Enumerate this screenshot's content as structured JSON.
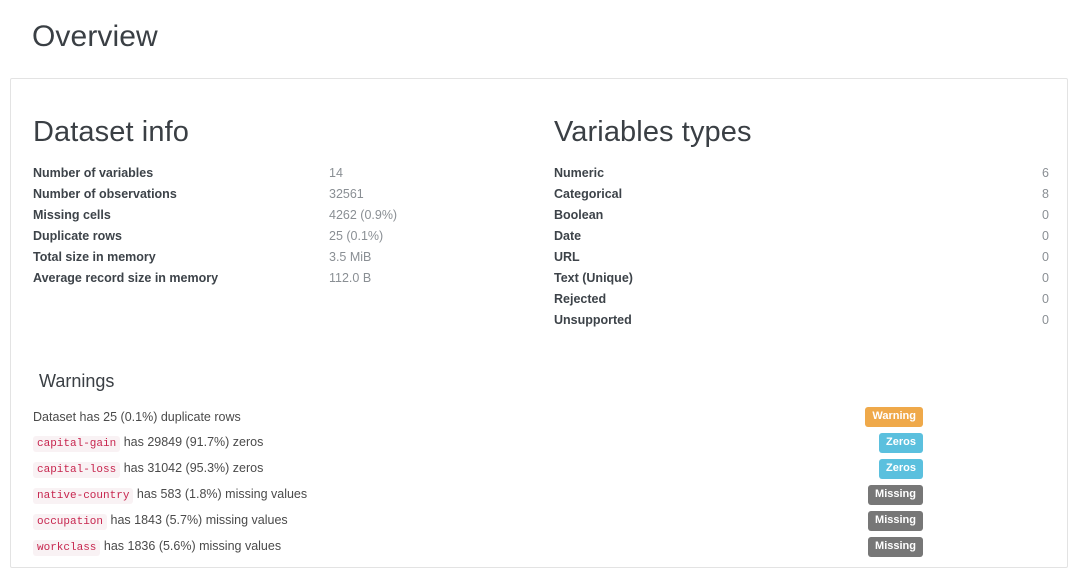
{
  "page": {
    "title": "Overview"
  },
  "dataset_info": {
    "heading": "Dataset info",
    "rows": [
      {
        "label": "Number of variables",
        "value": "14"
      },
      {
        "label": "Number of observations",
        "value": "32561"
      },
      {
        "label": "Missing cells",
        "value": "4262 (0.9%)"
      },
      {
        "label": "Duplicate rows",
        "value": "25 (0.1%)"
      },
      {
        "label": "Total size in memory",
        "value": "3.5 MiB"
      },
      {
        "label": "Average record size in memory",
        "value": "112.0 B"
      }
    ]
  },
  "variables_types": {
    "heading": "Variables types",
    "rows": [
      {
        "label": "Numeric",
        "value": "6"
      },
      {
        "label": "Categorical",
        "value": "8"
      },
      {
        "label": "Boolean",
        "value": "0"
      },
      {
        "label": "Date",
        "value": "0"
      },
      {
        "label": "URL",
        "value": "0"
      },
      {
        "label": "Text (Unique)",
        "value": "0"
      },
      {
        "label": "Rejected",
        "value": "0"
      },
      {
        "label": "Unsupported",
        "value": "0"
      }
    ]
  },
  "warnings": {
    "heading": "Warnings",
    "rows": [
      {
        "code": "",
        "text": "Dataset has 25 (0.1%) duplicate rows",
        "badge": "Warning",
        "badge_style": "label-warning"
      },
      {
        "code": "capital-gain",
        "text": "has 29849 (91.7%) zeros",
        "badge": "Zeros",
        "badge_style": "label-info"
      },
      {
        "code": "capital-loss",
        "text": "has 31042 (95.3%) zeros",
        "badge": "Zeros",
        "badge_style": "label-info"
      },
      {
        "code": "native-country",
        "text": "has 583 (1.8%) missing values",
        "badge": "Missing",
        "badge_style": "label-default"
      },
      {
        "code": "occupation",
        "text": "has 1843 (5.7%) missing values",
        "badge": "Missing",
        "badge_style": "label-default"
      },
      {
        "code": "workclass",
        "text": "has 1836 (5.6%) missing values",
        "badge": "Missing",
        "badge_style": "label-default"
      }
    ]
  },
  "colors": {
    "warning_badge": "#efa94a",
    "info_badge": "#5bc0de",
    "default_badge": "#777777",
    "code_text": "#c7254e",
    "code_background": "#f9f2f4",
    "card_border": "#e3e3e3",
    "heading_text": "#3a3f44",
    "value_text": "#8a8f94"
  }
}
